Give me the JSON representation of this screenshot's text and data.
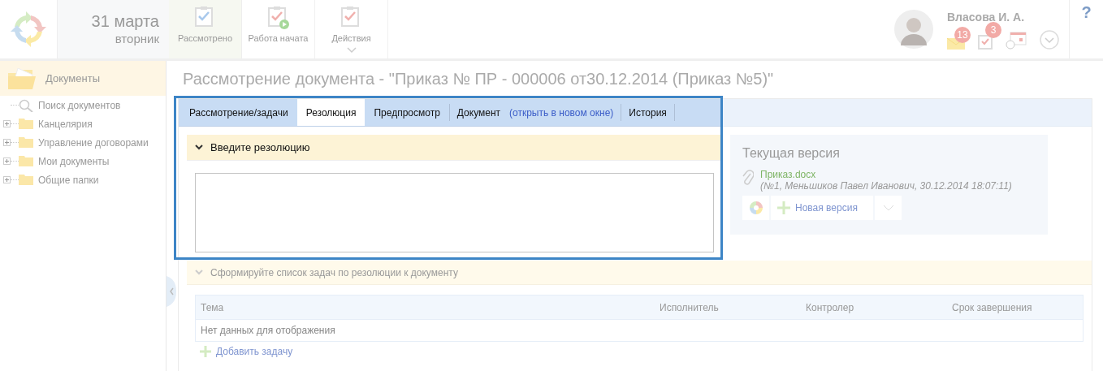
{
  "header": {
    "date": "31 марта",
    "weekday": "вторник",
    "actions": [
      {
        "label": "Рассмотрено",
        "kind": "reviewed",
        "selected": true
      },
      {
        "label": "Работа начата",
        "kind": "started",
        "selected": false
      },
      {
        "label": "Действия",
        "kind": "menu",
        "selected": false
      }
    ],
    "user": {
      "name": "Власова И. А.",
      "mail_count": "13",
      "task_count": "3"
    },
    "help": "?"
  },
  "sidebar": {
    "title": "Документы",
    "items": [
      {
        "label": "Поиск документов",
        "kind": "search"
      },
      {
        "label": "Канцелярия",
        "kind": "folder",
        "expanded": false
      },
      {
        "label": "Управление договорами",
        "kind": "folder",
        "expanded": false
      },
      {
        "label": "Мои документы",
        "kind": "folder",
        "expanded": false
      },
      {
        "label": "Общие папки",
        "kind": "folder",
        "expanded": false
      }
    ]
  },
  "page_title": "Рассмотрение документа - \"Приказ № ПР - 000006 от30.12.2014 (Приказ №5)\"",
  "tabs": [
    {
      "label": "Рассмотрение/задачи",
      "selected": false
    },
    {
      "label": "Резолюция",
      "selected": true
    },
    {
      "label": "Предпросмотр",
      "selected": false
    },
    {
      "label": "Документ",
      "link": "(открыть в новом окне)",
      "selected": false
    },
    {
      "label": "История",
      "selected": false
    }
  ],
  "resolution": {
    "title": "Введите резолюцию",
    "expanded": true
  },
  "current_version": {
    "title": "Текущая версия",
    "file": "Приказ.docx",
    "details": "(№1, Меньшиков Павел Иванович, 30.12.2014 18:07:11)",
    "new_version": "Новая версия"
  },
  "tasks": {
    "title": "Сформируйте список задач по резолюции к документу",
    "expanded": true,
    "columns": [
      "Тема",
      "Исполнитель",
      "Контролер",
      "Срок завершения"
    ],
    "empty": "Нет данных для отображения",
    "add": "Добавить задачу"
  }
}
